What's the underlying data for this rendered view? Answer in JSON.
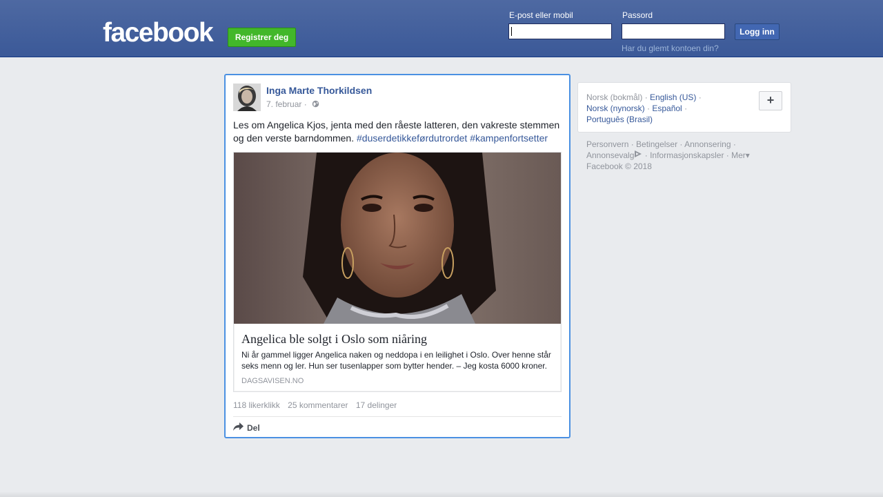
{
  "header": {
    "logo": "facebook",
    "register_label": "Registrer deg",
    "email_label": "E-post eller mobil",
    "password_label": "Passord",
    "login_label": "Logg inn",
    "forgot_label": "Har du glemt kontoen din?"
  },
  "post": {
    "author": "Inga Marte Thorkildsen",
    "date": "7. februar",
    "date_separator": "·",
    "privacy_icon": "globe-icon",
    "text": "Les om Angelica Kjos, jenta med den råeste latteren, den vakreste stemmen og den verste barndommen.",
    "hashtags": [
      "#duserdetikkeførdutrordet",
      "#kampenfortsetter"
    ],
    "link": {
      "title": "Angelica ble solgt i Oslo som niåring",
      "description": "Ni år gammel ligger Angelica naken og neddopa i en leilighet i Oslo. Over henne står seks menn og ler. Hun ser tusenlapper som bytter hender. – Jeg kosta 6000 kroner.",
      "domain": "DAGSAVISEN.NO"
    },
    "likes": "118 likerklikk",
    "comments": "25 kommentarer",
    "shares": "17 delinger",
    "share_label": "Del"
  },
  "sidebar": {
    "current_language": "Norsk (bokmål)",
    "languages": [
      "English (US)",
      "Norsk (nynorsk)",
      "Español",
      "Português (Brasil)"
    ],
    "add_label": "+",
    "footer": {
      "links": [
        "Personvern",
        "Betingelser",
        "Annonsering",
        "Annonsevalg",
        "Informasjonskapsler",
        "Mer"
      ],
      "copyright": "Facebook © 2018"
    }
  },
  "colors": {
    "brand_blue": "#3b5998",
    "register_green": "#42b72a",
    "link_blue": "#365899",
    "focus_border": "#4a90e2"
  }
}
